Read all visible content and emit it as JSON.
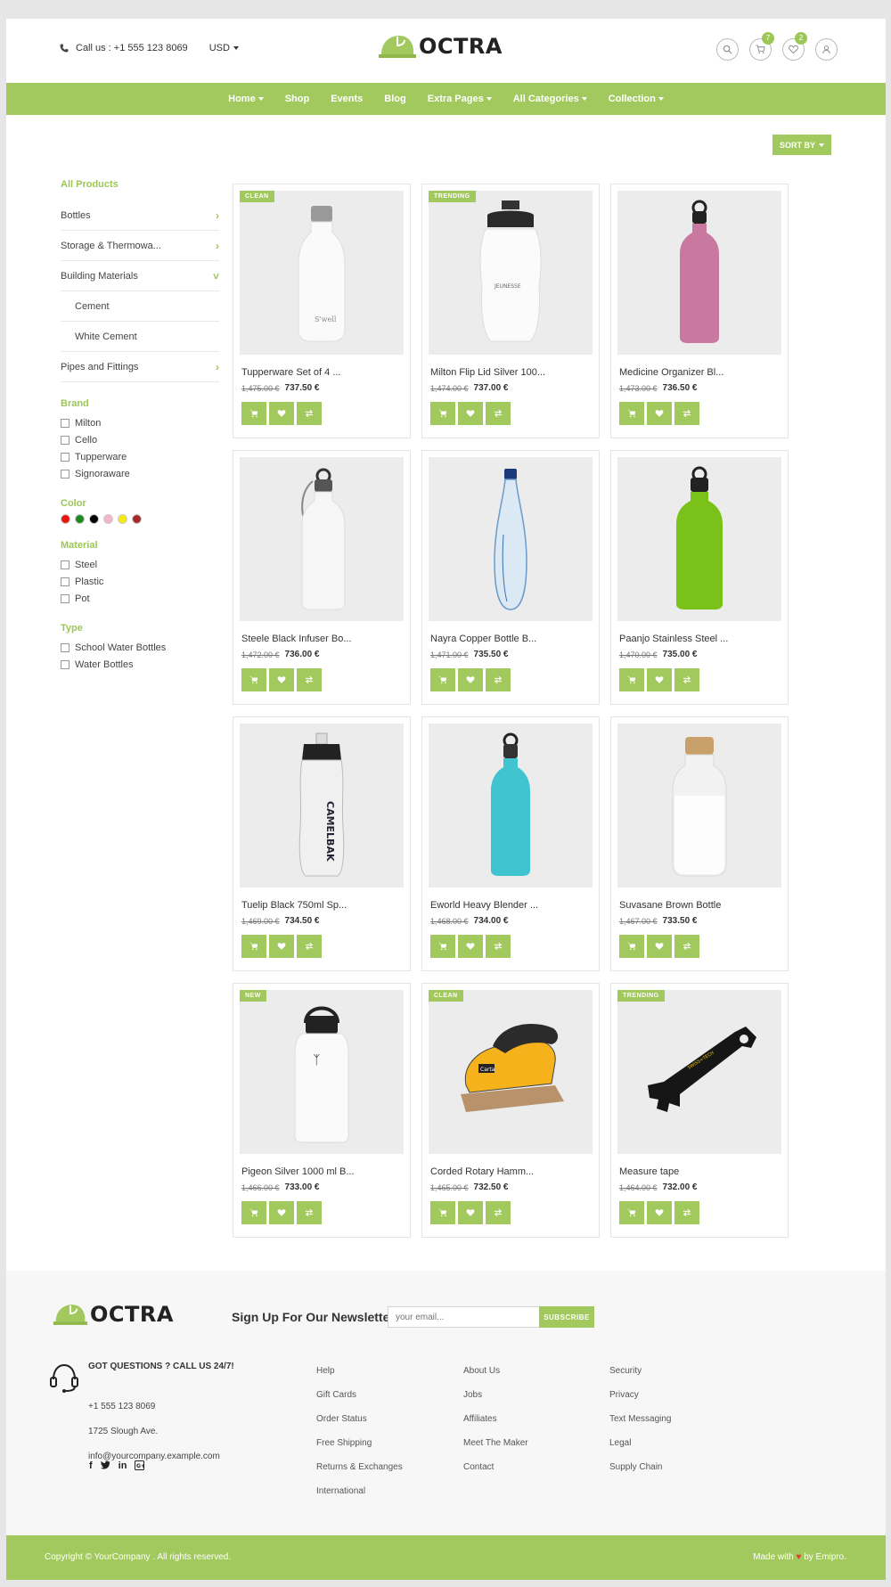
{
  "header": {
    "call": "Call us : +1 555 123 8069",
    "currency": "USD",
    "logo": "OCTRA",
    "cart_count": "7",
    "wishlist_count": "2"
  },
  "nav": [
    {
      "label": "Home",
      "dropdown": true
    },
    {
      "label": "Shop",
      "dropdown": false
    },
    {
      "label": "Events",
      "dropdown": false
    },
    {
      "label": "Blog",
      "dropdown": false
    },
    {
      "label": "Extra Pages",
      "dropdown": true
    },
    {
      "label": "All Categories",
      "dropdown": true
    },
    {
      "label": "Collection",
      "dropdown": true
    }
  ],
  "sort_label": "SORT BY",
  "sidebar": {
    "all_products": "All Products",
    "categories": [
      {
        "label": "Bottles",
        "expand": "›",
        "sub": false
      },
      {
        "label": "Storage & Thermowa...",
        "expand": "›",
        "sub": false
      },
      {
        "label": "Building Materials",
        "expand": "˅",
        "sub": false
      },
      {
        "label": "Cement",
        "expand": "",
        "sub": true
      },
      {
        "label": "White Cement",
        "expand": "",
        "sub": true
      },
      {
        "label": "Pipes and Fittings",
        "expand": "›",
        "sub": false
      }
    ],
    "brand_title": "Brand",
    "brands": [
      "Milton",
      "Cello",
      "Tupperware",
      "Signoraware"
    ],
    "color_title": "Color",
    "colors": [
      "#e8150f",
      "#1e8a1e",
      "#000000",
      "#f4b6c6",
      "#f7ea12",
      "#a52a2a"
    ],
    "material_title": "Material",
    "materials": [
      "Steel",
      "Plastic",
      "Pot"
    ],
    "type_title": "Type",
    "types": [
      "School Water Bottles",
      "Water Bottles"
    ]
  },
  "products": [
    {
      "name": "Tupperware Set of 4 ...",
      "old": "1,475.00 €",
      "price": "737.50 €",
      "tag": "CLEAN",
      "kind": "bottle-white-swell"
    },
    {
      "name": "Milton Flip Lid Silver 100...",
      "old": "1,474.00 €",
      "price": "737.00 €",
      "tag": "TRENDING",
      "kind": "bottle-sport"
    },
    {
      "name": "Medicine Organizer Bl...",
      "old": "1,473.00 €",
      "price": "736.50 €",
      "tag": "",
      "kind": "bottle-pink"
    },
    {
      "name": "Steele Black Infuser Bo...",
      "old": "1,472.00 €",
      "price": "736.00 €",
      "tag": "",
      "kind": "bottle-white-clip"
    },
    {
      "name": "Nayra Copper Bottle B...",
      "old": "1,471.00 €",
      "price": "735.50 €",
      "tag": "",
      "kind": "bottle-glass"
    },
    {
      "name": "Paanjo Stainless Steel ...",
      "old": "1,470.00 €",
      "price": "735.00 €",
      "tag": "",
      "kind": "bottle-green"
    },
    {
      "name": "Tuelip Black 750ml Sp...",
      "old": "1,469.00 €",
      "price": "734.50 €",
      "tag": "",
      "kind": "bottle-camelbak"
    },
    {
      "name": "Eworld Heavy Blender ...",
      "old": "1,468.00 €",
      "price": "734.00 €",
      "tag": "",
      "kind": "bottle-cyan"
    },
    {
      "name": "Suvasane Brown Bottle",
      "old": "1,467.00 €",
      "price": "733.50 €",
      "tag": "",
      "kind": "bottle-glass-white"
    },
    {
      "name": "Pigeon Silver 1000 ml B...",
      "old": "1,466.00 €",
      "price": "733.00 €",
      "tag": "NEW",
      "kind": "bottle-hydro"
    },
    {
      "name": "Corded Rotary Hamm...",
      "old": "1,465.00 €",
      "price": "732.50 €",
      "tag": "CLEAN",
      "kind": "sander"
    },
    {
      "name": "Measure tape",
      "old": "1,464.00 €",
      "price": "732.00 €",
      "tag": "TRENDING",
      "kind": "multitool"
    }
  ],
  "footer": {
    "logo": "OCTRA",
    "newsletter_title": "Sign Up For Our Newsletter!",
    "email_placeholder": "your email...",
    "subscribe": "SUBSCRIBE",
    "questions": "GOT QUESTIONS ? CALL US 24/7!",
    "phone": "+1 555 123 8069",
    "address": "1725 Slough Ave.",
    "email": "info@yourcompany.example.com",
    "col1": [
      "Help",
      "Gift Cards",
      "Order Status",
      "Free Shipping",
      "Returns & Exchanges",
      "International"
    ],
    "col2": [
      "About Us",
      "Jobs",
      "Affiliates",
      "Meet The Maker",
      "Contact"
    ],
    "col3": [
      "Security",
      "Privacy",
      "Text Messaging",
      "Legal",
      "Supply Chain"
    ],
    "copyright": "Copyright © YourCompany . All rights reserved.",
    "made_prefix": "Made with",
    "made_suffix": "by Emipro."
  },
  "brand_color": "#a2c95d"
}
